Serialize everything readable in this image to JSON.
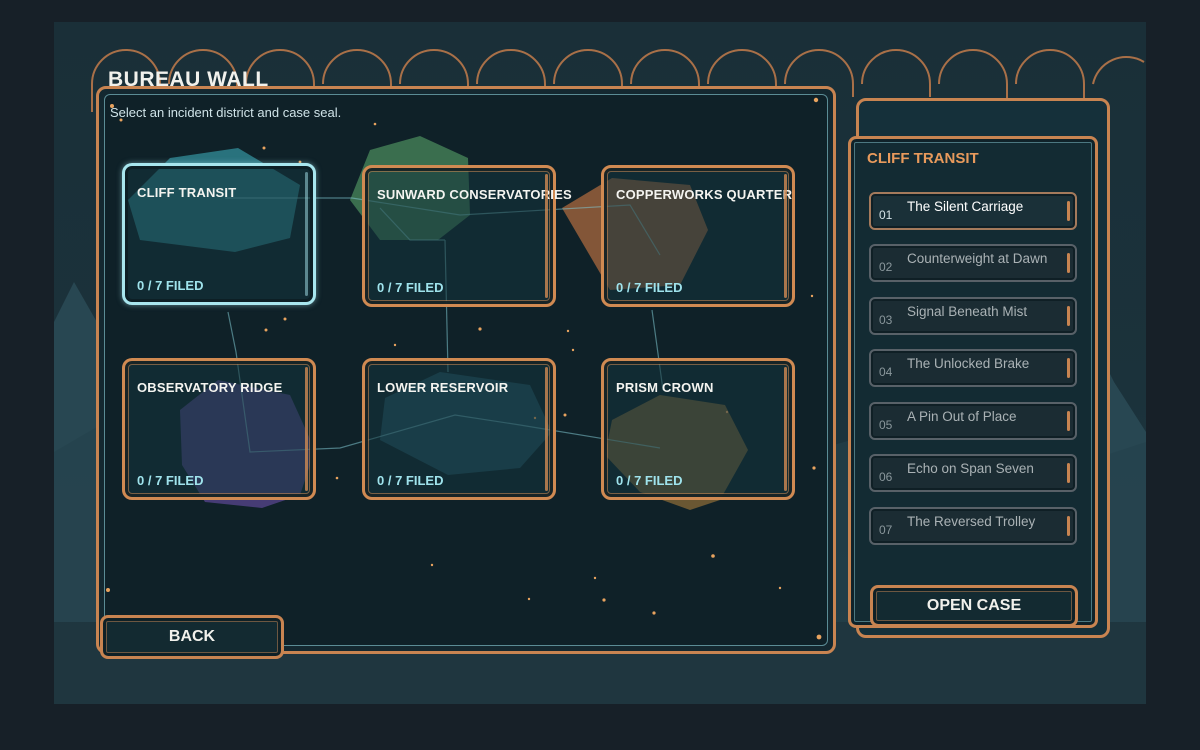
{
  "screen": {
    "title": "BUREAU WALL",
    "subtitle": "Select an incident district and case seal."
  },
  "districts": [
    {
      "name": "CLIFF TRANSIT",
      "progress": "0 / 7 FILED",
      "filed": 0,
      "total": 7,
      "selected": true,
      "seal_color": "#3fb7c3"
    },
    {
      "name": "SUNWARD CONSERVATORIES",
      "progress": "0 / 7 FILED",
      "filed": 0,
      "total": 7,
      "selected": false,
      "seal_color": "#5fae6e"
    },
    {
      "name": "COPPERWORKS QUARTER",
      "progress": "0 / 7 FILED",
      "filed": 0,
      "total": 7,
      "selected": false,
      "seal_color": "#d17a43"
    },
    {
      "name": "OBSERVATORY RIDGE",
      "progress": "0 / 7 FILED",
      "filed": 0,
      "total": 7,
      "selected": false,
      "seal_color": "#7e57c2"
    },
    {
      "name": "LOWER RESERVOIR",
      "progress": "0 / 7 FILED",
      "filed": 0,
      "total": 7,
      "selected": false,
      "seal_color": "#2f6f86"
    },
    {
      "name": "PRISM CROWN",
      "progress": "0 / 7 FILED",
      "filed": 0,
      "total": 7,
      "selected": false,
      "seal_color": "#d99a40"
    }
  ],
  "back_label": "BACK",
  "case_panel": {
    "title": "CLIFF TRANSIT",
    "cases": [
      {
        "num": "01",
        "title": "The Silent Carriage",
        "active": true
      },
      {
        "num": "02",
        "title": "Counterweight at Dawn",
        "active": false
      },
      {
        "num": "03",
        "title": "Signal Beneath Mist",
        "active": false
      },
      {
        "num": "04",
        "title": "The Unlocked Brake",
        "active": false
      },
      {
        "num": "05",
        "title": "A Pin Out of Place",
        "active": false
      },
      {
        "num": "06",
        "title": "Echo on Span Seven",
        "active": false
      },
      {
        "num": "07",
        "title": "The Reversed Trolley",
        "active": false
      }
    ],
    "open_label": "OPEN CASE"
  },
  "colors": {
    "accent": "#c88451",
    "selection": "#a8e6ee",
    "progress_text": "#9fe3ec",
    "panel_title": "#e89a5c",
    "background": "#1b323b"
  }
}
